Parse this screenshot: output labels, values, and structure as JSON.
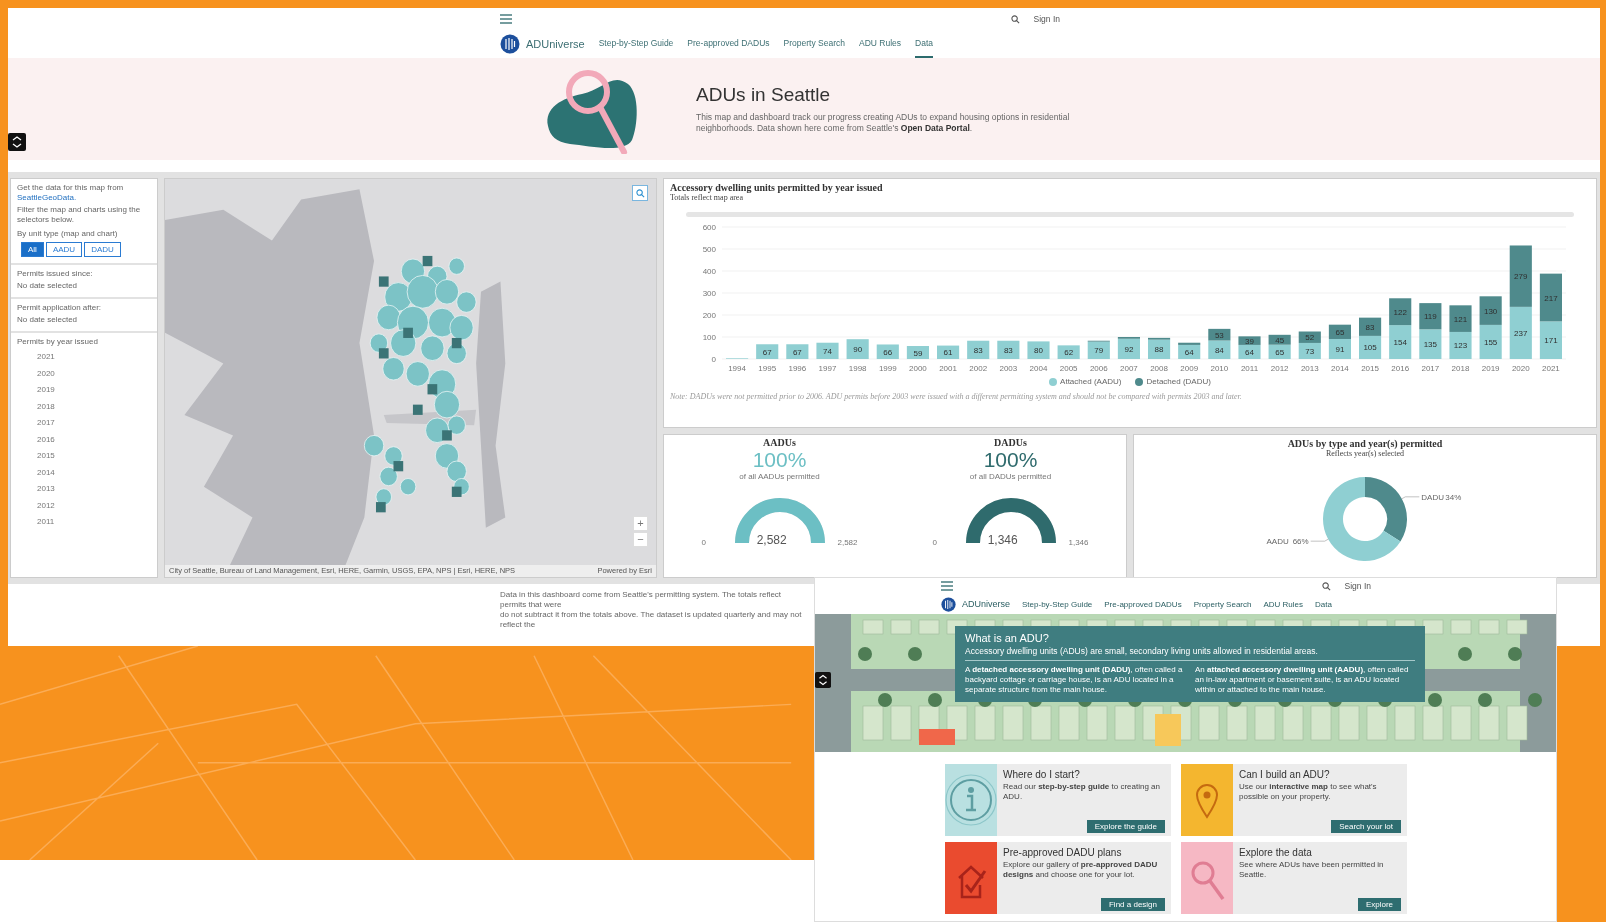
{
  "dashboard_page": {
    "header": {
      "sign_in": "Sign In",
      "brand": "ADUniverse",
      "nav": [
        {
          "label": "Step-by-Step Guide",
          "selected": false
        },
        {
          "label": "Pre-approved DADUs",
          "selected": false
        },
        {
          "label": "Property Search",
          "selected": false
        },
        {
          "label": "ADU Rules",
          "selected": false
        },
        {
          "label": "Data",
          "selected": true
        }
      ]
    },
    "hero": {
      "title": "ADUs in Seattle",
      "text": "This map and dashboard track our progress creating ADUs to expand housing options in residential neighborhoods. Data shown here come from Seattle's",
      "link": "Open Data Portal",
      "text_after": "."
    },
    "sidebar": {
      "intro": "Get the data for this map from",
      "intro_link": "SeattleGeoData.",
      "filter_hint": "Filter the map and charts using the selectors below.",
      "unit_type_label": "By unit type (map and chart)",
      "unit_types": [
        {
          "label": "All",
          "selected": true
        },
        {
          "label": "AADU",
          "selected": false
        },
        {
          "label": "DADU",
          "selected": false
        }
      ],
      "filters": [
        {
          "label": "Permits issued since:",
          "value": "No date selected"
        },
        {
          "label": "Permit application after:",
          "value": "No date selected"
        }
      ],
      "years_label": "Permits by year issued",
      "years": [
        "2021",
        "2020",
        "2019",
        "2018",
        "2017",
        "2016",
        "2015",
        "2014",
        "2013",
        "2012",
        "2011"
      ]
    },
    "map": {
      "attribution": "City of Seattle, Bureau of Land Management, Esri, HERE, Garmin, USGS, EPA, NPS | Esri, HERE, NPS",
      "powered_by": "Powered by Esri",
      "zoom_in": "+",
      "zoom_out": "−"
    },
    "bar_chart": {
      "subtitle": "Totals reflect map area",
      "note": "Note: DADUs were not permitted prior to 2006. ADU permits before 2003 were issued with a different permitting system and should not be compared with permits 2003 and later.",
      "chart_data": {
        "type": "bar",
        "title": "Accessory dwelling units permitted by year issued",
        "categories": [
          "1994",
          "1995",
          "1996",
          "1997",
          "1998",
          "1999",
          "2000",
          "2001",
          "2002",
          "2003",
          "2004",
          "2005",
          "2006",
          "2007",
          "2008",
          "2009",
          "2010",
          "2011",
          "2012",
          "2013",
          "2014",
          "2015",
          "2016",
          "2017",
          "2018",
          "2019",
          "2020",
          "2021"
        ],
        "stacked": true,
        "grid": true,
        "ylim": [
          0,
          600
        ],
        "yticks": [
          0,
          100,
          200,
          300,
          400,
          500,
          600
        ],
        "series": [
          {
            "name": "Attached (AADU)",
            "color": "#8fcfd2",
            "values": [
              3,
              67,
              67,
              74,
              90,
              66,
              59,
              61,
              83,
              83,
              80,
              62,
              79,
              92,
              88,
              64,
              84,
              64,
              65,
              73,
              91,
              105,
              154,
              135,
              123,
              155,
              237,
              171
            ],
            "value_labels": [
              null,
              "67",
              "67",
              "74",
              "90",
              "66",
              "59",
              "61",
              "83",
              "83",
              "80",
              "62",
              "79",
              "92",
              "88",
              "64",
              "84",
              "64",
              "65",
              "73",
              "91",
              "105",
              "154",
              "135",
              "123",
              "155",
              "237",
              "171"
            ]
          },
          {
            "name": "Detached (DADU)",
            "color": "#4f8a8c",
            "values": [
              null,
              null,
              null,
              null,
              null,
              null,
              null,
              null,
              null,
              null,
              null,
              null,
              4,
              8,
              8,
              10,
              53,
              39,
              45,
              52,
              65,
              83,
              122,
              119,
              121,
              130,
              279,
              217
            ],
            "value_labels": [
              null,
              null,
              null,
              null,
              null,
              null,
              null,
              null,
              null,
              null,
              null,
              null,
              null,
              null,
              null,
              null,
              "53",
              "39",
              "45",
              "52",
              "65",
              "83",
              "122",
              "119",
              "121",
              "130",
              "279",
              "217"
            ]
          }
        ]
      }
    },
    "gauges": [
      {
        "title": "AADUs",
        "percent": "100%",
        "caption": "of all AADUs permitted",
        "min": "0",
        "value": "2,582",
        "max": "2,582",
        "level": 1,
        "color": "#6cbfc4"
      },
      {
        "title": "DADUs",
        "percent": "100%",
        "caption": "of all DADUs permitted",
        "min": "0",
        "value": "1,346",
        "max": "1,346",
        "level": 1,
        "color": "#2f6b6d"
      }
    ],
    "donut": {
      "subtitle": "Reflects year(s) selected",
      "chart_data": {
        "type": "donut",
        "title": "ADUs by type and year(s) permitted",
        "categories": [
          "AADU",
          "DADU"
        ],
        "values": [
          66,
          34
        ],
        "value_labels": [
          "66%",
          "34%"
        ]
      }
    },
    "footer_lines": [
      "Data in this dashboard come from Seattle's permitting system. The totals reflect permits that were",
      "do not subtract it from the totals above. The dataset is updated quarterly and may not reflect the"
    ]
  },
  "home_page": {
    "header": {
      "sign_in": "Sign In",
      "brand": "ADUniverse",
      "nav": [
        "Step-by-Step Guide",
        "Pre-approved DADUs",
        "Property Search",
        "ADU Rules",
        "Data"
      ]
    },
    "intro": {
      "title": "What is an ADU?",
      "subtitle": "Accessory dwelling units (ADUs) are small, secondary living units allowed in residential areas.",
      "columns": [
        "A **detached accessory dwelling unit (DADU)**, often called a backyard cottage or carriage house, is an ADU located in a separate structure from the main house.",
        "An **attached accessory dwelling unit (AADU)**, often called an in-law apartment or basement suite, is an ADU located within or attached to the main house."
      ]
    },
    "cards": [
      {
        "title": "Where do I start?",
        "text": "Read our **step-by-step guide** to creating an ADU.",
        "button": "Explore the guide"
      },
      {
        "title": "Can I build an ADU?",
        "text": "Use our **interactive map** to see what's possible on your property.",
        "button": "Search your lot"
      },
      {
        "title": "Pre-approved DADU plans",
        "text": "Explore our gallery of **pre-approved DADU designs** and choose one for your lot.",
        "button": "Find a design"
      },
      {
        "title": "Explore the data",
        "text": "See where ADUs have been permitted in Seattle.",
        "button": "Explore"
      }
    ]
  }
}
